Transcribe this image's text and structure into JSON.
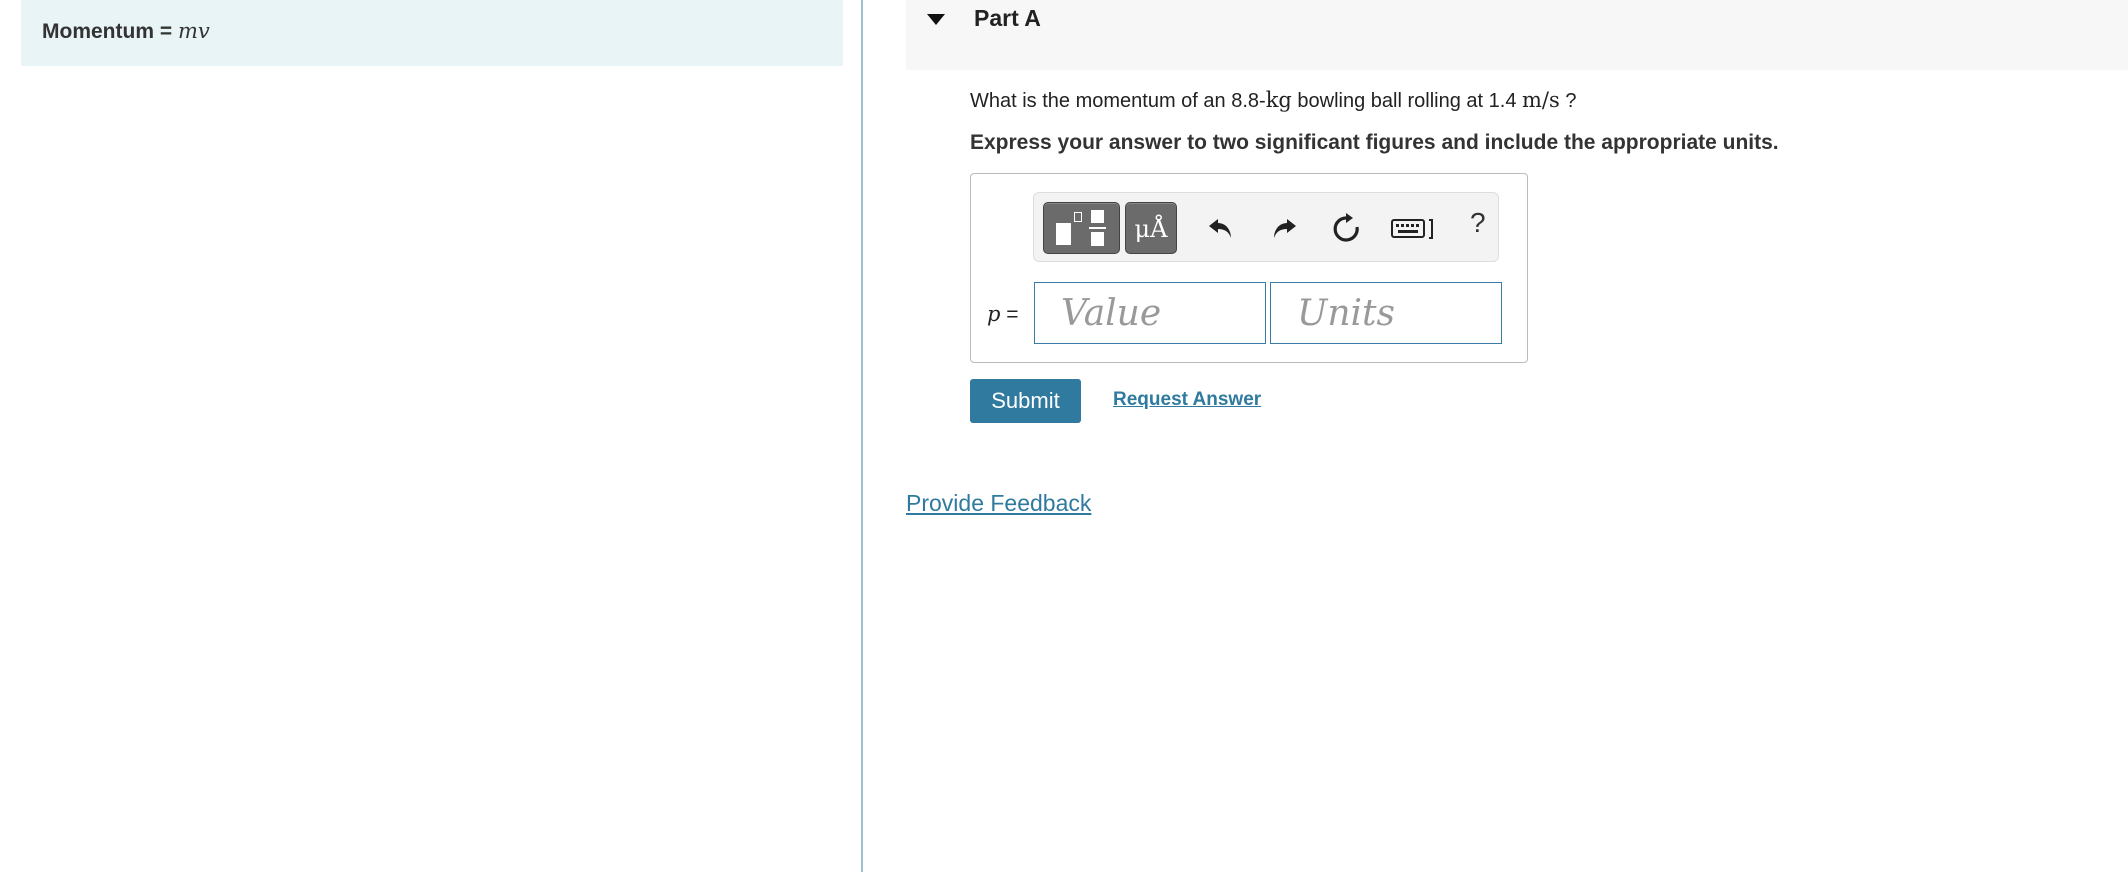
{
  "hint": {
    "label": "Momentum",
    "equals": " = ",
    "formula": "mv"
  },
  "part": {
    "title": "Part A",
    "question_pre": "What is the momentum of an 8.8-",
    "question_mass_unit": "kg",
    "question_mid": " bowling ball rolling at 1.4 ",
    "question_speed_unit": "m/s",
    "question_post": " ?",
    "instruction": "Express your answer to two significant figures and include the appropriate units."
  },
  "answer": {
    "variable": "p",
    "equals": " =",
    "value_placeholder": "Value",
    "units_placeholder": "Units",
    "value": "",
    "units": ""
  },
  "toolbar": {
    "templates_icon": "templates-icon",
    "symbols_label": "μÅ",
    "undo_icon": "undo-icon",
    "redo_icon": "redo-icon",
    "reset_icon": "reset-icon",
    "keyboard_icon": "keyboard-icon",
    "help_label": "?"
  },
  "actions": {
    "submit_label": "Submit",
    "request_answer_label": "Request Answer"
  },
  "footer": {
    "feedback_label": "Provide Feedback"
  },
  "colors": {
    "accent": "#2f7a9e",
    "hint_background": "#e9f4f6",
    "toolbar_button": "#6b6b6b"
  }
}
